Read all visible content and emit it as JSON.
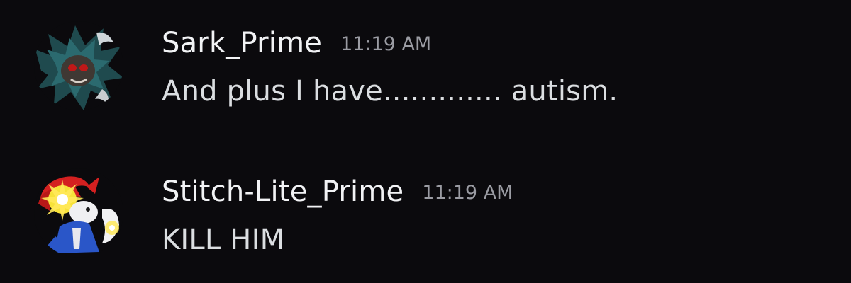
{
  "messages": [
    {
      "username": "Sark_Prime",
      "timestamp": "11:19 AM",
      "content": "And plus I have............. autism.",
      "avatar_icon": "dark-hedgehog-avatar"
    },
    {
      "username": "Stitch-Lite_Prime",
      "timestamp": "11:19 AM",
      "content": "KILL HIM",
      "avatar_icon": "glowing-fox-avatar"
    }
  ],
  "colors": {
    "background": "#0b0a0d",
    "username": "#f2f3f5",
    "timestamp": "#9b9ca3",
    "content": "#dbdee1"
  }
}
